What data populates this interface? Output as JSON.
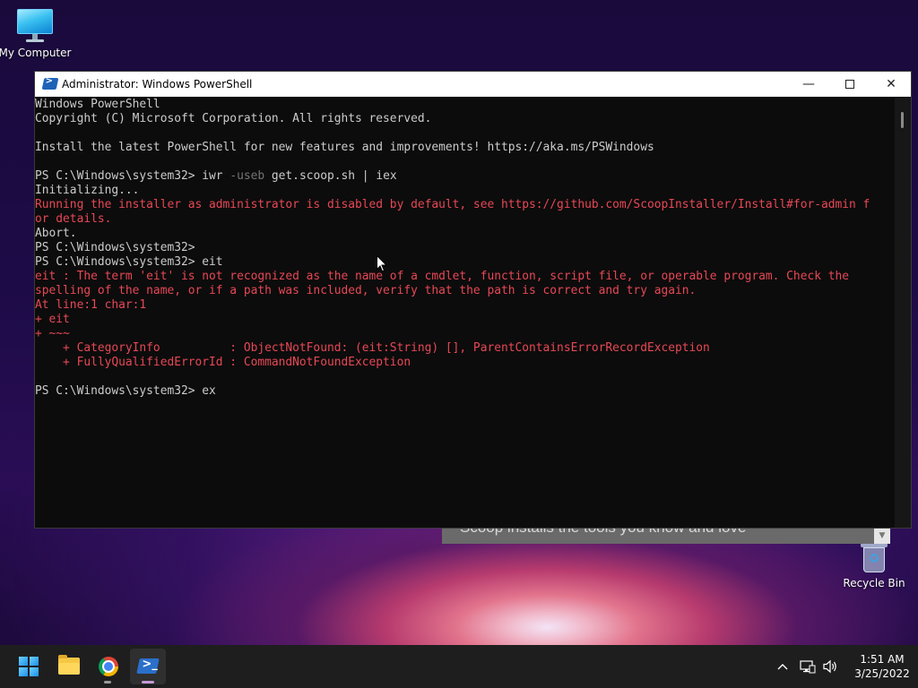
{
  "desktop": {
    "icons": [
      {
        "label": "My Computer"
      },
      {
        "label": "Recycle Bin"
      }
    ]
  },
  "background_window": {
    "visible_text": "Scoop installs the tools you know and love"
  },
  "powershell_window": {
    "title": "Administrator: Windows PowerShell",
    "controls": {
      "minimize": "—",
      "close": "✕"
    },
    "console_lines": [
      {
        "type": "normal",
        "text": "Windows PowerShell"
      },
      {
        "type": "normal",
        "text": "Copyright (C) Microsoft Corporation. All rights reserved."
      },
      {
        "type": "normal",
        "text": ""
      },
      {
        "type": "normal",
        "text": "Install the latest PowerShell for new features and improvements! https://aka.ms/PSWindows"
      },
      {
        "type": "normal",
        "text": ""
      },
      {
        "type": "command",
        "prompt": "PS C:\\Windows\\system32> ",
        "cmd": "iwr",
        "param": " -useb",
        "rest": " get.scoop.sh | iex"
      },
      {
        "type": "normal",
        "text": "Initializing..."
      },
      {
        "type": "error",
        "text": "Running the installer as administrator is disabled by default, see https://github.com/ScoopInstaller/Install#for-admin f"
      },
      {
        "type": "error",
        "text": "or details."
      },
      {
        "type": "normal",
        "text": "Abort."
      },
      {
        "type": "normal",
        "text": "PS C:\\Windows\\system32>"
      },
      {
        "type": "normal",
        "text": "PS C:\\Windows\\system32> eit"
      },
      {
        "type": "error",
        "text": "eit : The term 'eit' is not recognized as the name of a cmdlet, function, script file, or operable program. Check the"
      },
      {
        "type": "error",
        "text": "spelling of the name, or if a path was included, verify that the path is correct and try again."
      },
      {
        "type": "error",
        "text": "At line:1 char:1"
      },
      {
        "type": "error",
        "text": "+ eit"
      },
      {
        "type": "error",
        "text": "+ ~~~"
      },
      {
        "type": "error",
        "text": "    + CategoryInfo          : ObjectNotFound: (eit:String) [], ParentContainsErrorRecordException"
      },
      {
        "type": "error",
        "text": "    + FullyQualifiedErrorId : CommandNotFoundException"
      },
      {
        "type": "normal",
        "text": ""
      },
      {
        "type": "normal",
        "text": "PS C:\\Windows\\system32> ex"
      }
    ]
  },
  "taskbar": {
    "items": [
      "start-icon",
      "folder-icon",
      "chrome-icon",
      "powershell-icon"
    ],
    "active_item": "powershell-icon",
    "tray": {
      "chevron": "^",
      "time": "1:51 AM",
      "date": "3/25/2022"
    }
  },
  "colors": {
    "console_bg": "#0c0c0c",
    "console_text": "#cccccc",
    "error_text": "#e74856",
    "param_text": "#767676",
    "taskbar_bg": "#1e1e1e"
  }
}
